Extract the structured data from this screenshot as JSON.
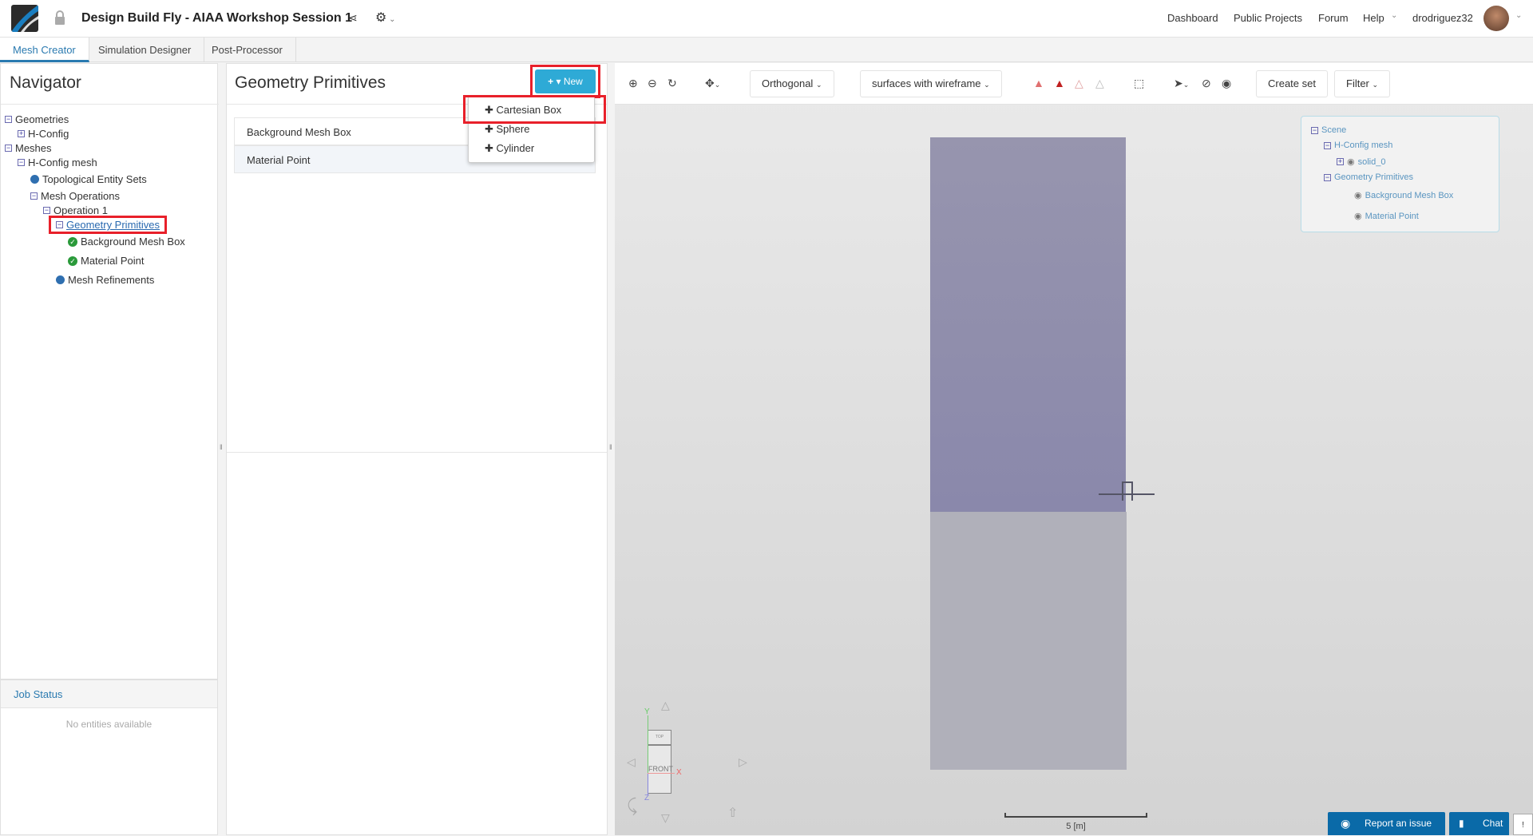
{
  "header": {
    "title": "Design Build Fly - AIAA Workshop Session 1",
    "nav": [
      "Dashboard",
      "Public Projects",
      "Forum",
      "Help"
    ],
    "username": "drodriguez32"
  },
  "tabs": [
    "Mesh Creator",
    "Simulation Designer",
    "Post-Processor"
  ],
  "navigator": {
    "title": "Navigator",
    "tree": [
      {
        "label": "Geometries",
        "toggle": "−"
      },
      {
        "label": "H-Config",
        "toggle": "+"
      },
      {
        "label": "Meshes",
        "toggle": "−"
      },
      {
        "label": "H-Config mesh",
        "toggle": "−"
      },
      {
        "label": "Topological Entity Sets"
      },
      {
        "label": "Mesh Operations",
        "toggle": "−"
      },
      {
        "label": "Operation 1",
        "toggle": "−"
      },
      {
        "label": "Geometry Primitives",
        "toggle": "−"
      },
      {
        "label": "Background Mesh Box"
      },
      {
        "label": "Material Point"
      },
      {
        "label": "Mesh Refinements"
      }
    ]
  },
  "job_status": {
    "title": "Job Status",
    "empty": "No entities available"
  },
  "primitives": {
    "title": "Geometry Primitives",
    "new_label": "New",
    "items": [
      "Background Mesh Box",
      "Material Point"
    ],
    "menu": [
      "Cartesian Box",
      "Sphere",
      "Cylinder"
    ]
  },
  "toolbar": {
    "projection": "Orthogonal",
    "render_mode": "surfaces with wireframe",
    "create_set": "Create set",
    "filter": "Filter"
  },
  "scene": {
    "items": [
      "Scene",
      "H-Config mesh",
      "solid_0",
      "Geometry Primitives",
      "Background Mesh Box",
      "Material Point"
    ]
  },
  "viewport": {
    "scale_label": "5 [m]",
    "gizmo": {
      "front": "FRONT",
      "top": "TOP",
      "x": "X",
      "y": "Y",
      "z": "Z"
    }
  },
  "footer": {
    "report": "Report an issue",
    "chat": "Chat"
  },
  "colors": {
    "accent": "#2a7ab0",
    "new_button": "#2eaad6",
    "highlight": "#e8202a",
    "mesh_box": "#8a88ab",
    "report": "#0a6aa8"
  }
}
